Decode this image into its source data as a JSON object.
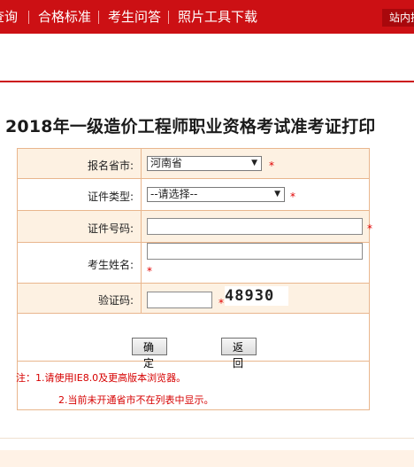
{
  "nav": {
    "items": [
      "查询",
      "合格标准",
      "考生问答",
      "照片工具下载"
    ],
    "site_search": "站内搜"
  },
  "page_title": "2018年一级造价工程师职业资格考试准考证打印",
  "form": {
    "province_label": "报名省市:",
    "province_value": "河南省",
    "cert_type_label": "证件类型:",
    "cert_type_value": "--请选择--",
    "cert_no_label": "证件号码:",
    "cert_no_value": "",
    "name_label": "考生姓名:",
    "name_value": "",
    "captcha_label": "验证码:",
    "captcha_value": "",
    "captcha_text": "48930",
    "required_mark": "*"
  },
  "buttons": {
    "confirm": "确定",
    "back": "返回"
  },
  "notes": {
    "line1": "注：1.请使用IE8.0及更高版本浏览器。",
    "line2": "2.当前未开通省市不在列表中显示。"
  },
  "colors": {
    "nav_bg": "#cc1014",
    "row_shade": "#fdf1e2",
    "border": "#e9b68d",
    "required": "#e00000"
  }
}
